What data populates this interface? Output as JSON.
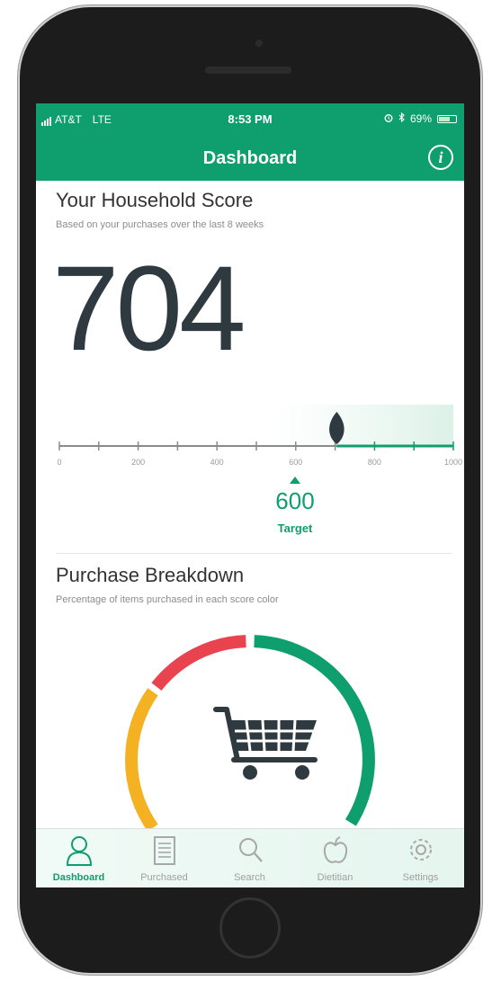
{
  "status_bar": {
    "carrier": "AT&T",
    "network": "LTE",
    "time": "8:53 PM",
    "battery": "69%",
    "battery_level": 0.69
  },
  "nav": {
    "title": "Dashboard",
    "info_icon": "info-icon"
  },
  "household_score": {
    "title": "Your Household Score",
    "subtitle": "Based on your purchases over the last 8 weeks",
    "value": "704",
    "scale": {
      "min": 0,
      "max": 1000,
      "current": 704,
      "tick_labels": [
        "0",
        "200",
        "400",
        "600",
        "800",
        "1000"
      ]
    },
    "target_value": "600",
    "target_label": "Target"
  },
  "purchase_breakdown": {
    "title": "Purchase Breakdown",
    "subtitle": "Percentage of items purchased in each score color",
    "center_icon": "shopping-cart-icon",
    "colors": {
      "green": "#0f9e6e",
      "red": "#e8434f",
      "yellow": "#f4b223"
    }
  },
  "tab_bar": {
    "items": [
      {
        "label": "Dashboard",
        "icon": "person-icon",
        "active": true
      },
      {
        "label": "Purchased",
        "icon": "receipt-icon",
        "active": false
      },
      {
        "label": "Search",
        "icon": "search-icon",
        "active": false
      },
      {
        "label": "Dietitian",
        "icon": "apple-icon",
        "active": false
      },
      {
        "label": "Settings",
        "icon": "gear-icon",
        "active": false
      }
    ]
  },
  "theme": {
    "accent": "#0f9e6e",
    "text_dark": "#2f3a40"
  }
}
